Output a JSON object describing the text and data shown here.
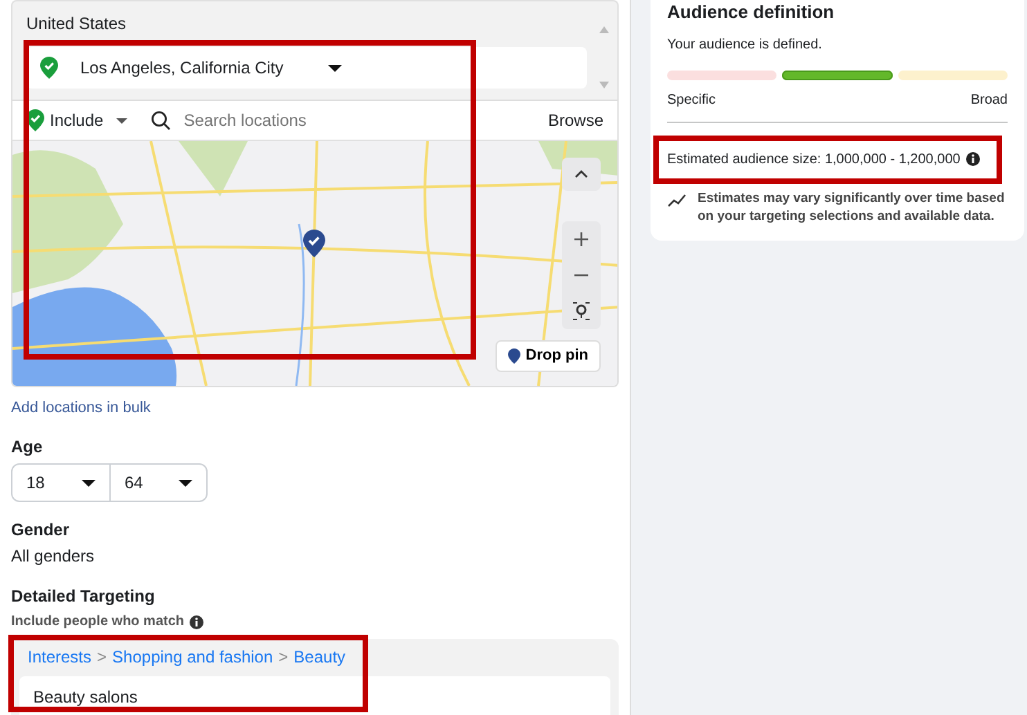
{
  "location_list": {
    "country": "United States",
    "locations": [
      {
        "name": "Los Angeles, California City",
        "included": true
      }
    ],
    "highlighted": true
  },
  "location_search": {
    "mode": "Include",
    "placeholder": "Search locations",
    "browse": "Browse"
  },
  "map": {
    "drop_pin": "Drop pin"
  },
  "bulk_link": "Add locations in bulk",
  "age": {
    "label": "Age",
    "min": "18",
    "max": "64"
  },
  "gender": {
    "label": "Gender",
    "value": "All genders"
  },
  "detailed_targeting": {
    "label": "Detailed Targeting",
    "hint": "Include people who match",
    "breadcrumb": [
      "Interests",
      "Shopping and fashion",
      "Beauty"
    ],
    "separator": ">",
    "items": [
      "Beauty salons"
    ],
    "highlighted": true
  },
  "audience": {
    "title": "Audience definition",
    "status": "Your audience is defined.",
    "segments": [
      {
        "selected": false,
        "color": "#fbdcdc"
      },
      {
        "selected": true,
        "color": "#63b82a"
      },
      {
        "selected": false,
        "color": "#fdf0c8"
      }
    ],
    "low_label": "Specific",
    "high_label": "Broad",
    "size": "Estimated audience size: 1,000,000 - 1,200,000",
    "size_highlighted": true,
    "note": "Estimates may vary significantly over time based on your targeting selections and available data."
  }
}
